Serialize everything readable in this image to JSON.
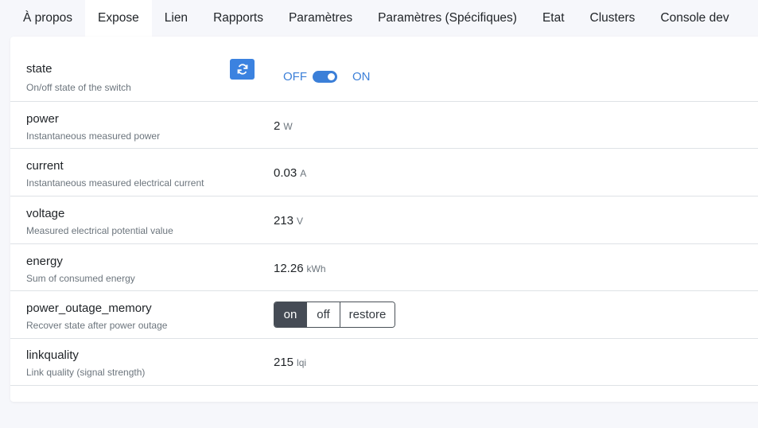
{
  "tabs": [
    {
      "label": "À propos"
    },
    {
      "label": "Expose"
    },
    {
      "label": "Lien"
    },
    {
      "label": "Rapports"
    },
    {
      "label": "Paramètres"
    },
    {
      "label": "Paramètres (Spécifiques)"
    },
    {
      "label": "Etat"
    },
    {
      "label": "Clusters"
    },
    {
      "label": "Console dev"
    }
  ],
  "active_tab": "Expose",
  "rows": {
    "state": {
      "name": "state",
      "desc": "On/off state of the switch",
      "off_label": "OFF",
      "on_label": "ON",
      "switch_on": true
    },
    "power": {
      "name": "power",
      "desc": "Instantaneous measured power",
      "value": "2",
      "unit": "W"
    },
    "current": {
      "name": "current",
      "desc": "Instantaneous measured electrical current",
      "value": "0.03",
      "unit": "A"
    },
    "voltage": {
      "name": "voltage",
      "desc": "Measured electrical potential value",
      "value": "213",
      "unit": "V"
    },
    "energy": {
      "name": "energy",
      "desc": "Sum of consumed energy",
      "value": "12.26",
      "unit": "kWh"
    },
    "power_outage_memory": {
      "name": "power_outage_memory",
      "desc": "Recover state after power outage",
      "options": [
        "on",
        "off",
        "restore"
      ],
      "selected": "on"
    },
    "linkquality": {
      "name": "linkquality",
      "desc": "Link quality (signal strength)",
      "value": "215",
      "unit": "lqi"
    }
  },
  "colors": {
    "accent": "#3b7fd8",
    "selected_option": "#454b55"
  },
  "icons": {
    "refresh": "refresh-icon"
  }
}
